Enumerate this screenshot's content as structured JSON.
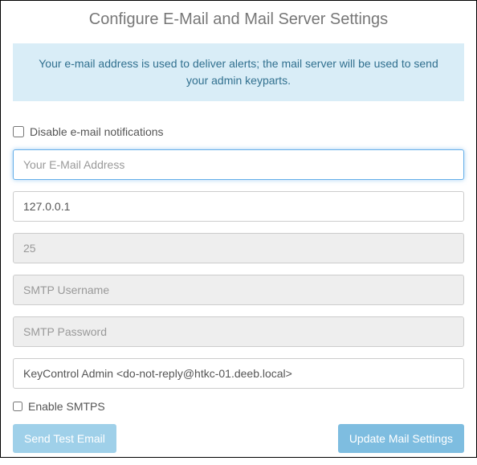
{
  "title": "Configure E-Mail and Mail Server Settings",
  "info_banner": "Your e-mail address is used to deliver alerts; the mail server will be used to send your admin keyparts.",
  "disable_notifications": {
    "label": "Disable e-mail notifications",
    "checked": false
  },
  "fields": {
    "email": {
      "placeholder": "Your E-Mail Address",
      "value": ""
    },
    "server": {
      "value": "127.0.0.1"
    },
    "port": {
      "value": "25"
    },
    "smtp_username": {
      "placeholder": "SMTP Username",
      "value": ""
    },
    "smtp_password": {
      "placeholder": "SMTP Password",
      "value": ""
    },
    "from_address": {
      "value": "KeyControl Admin <do-not-reply@htkc-01.deeb.local>"
    }
  },
  "enable_smtps": {
    "label": "Enable SMTPS",
    "checked": false
  },
  "buttons": {
    "send_test": "Send Test Email",
    "update": "Update Mail Settings"
  }
}
